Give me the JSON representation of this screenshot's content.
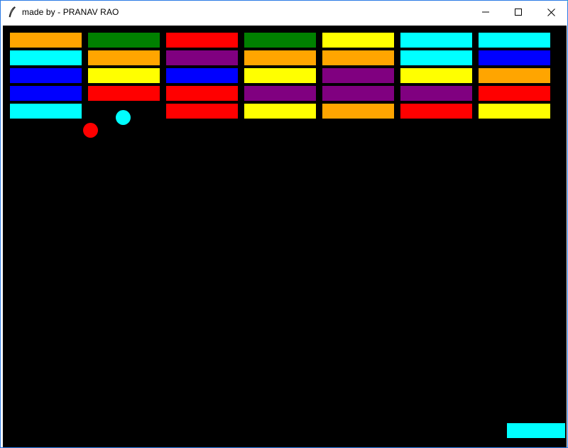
{
  "window": {
    "title": "made by - PRANAV RAO",
    "app_icon": "feather-icon",
    "controls": [
      "minimize-icon",
      "maximize-icon",
      "close-icon"
    ],
    "accent": "#2c7be5"
  },
  "game": {
    "background": "#000000",
    "brick_rows": [
      [
        "#ffa500",
        "#008000",
        "#ff0000",
        "#008000",
        "#ffff00",
        "#00ffff",
        "#00ffff"
      ],
      [
        "#00ffff",
        "#ffa500",
        "#800080",
        "#ffa500",
        "#ffa500",
        "#00ffff",
        "#0000ff"
      ],
      [
        "#0000ff",
        "#ffff00",
        "#0000ff",
        "#ffff00",
        "#800080",
        "#ffff00",
        "#ffa500"
      ],
      [
        "#0000ff",
        "#ff0000",
        "#ff0000",
        "#800080",
        "#800080",
        "#800080",
        "#ff0000"
      ],
      [
        "#00ffff",
        null,
        "#ff0000",
        "#ffff00",
        "#ffa500",
        "#ff0000",
        "#ffff00"
      ]
    ],
    "balls": [
      {
        "color": "#ff0000"
      },
      {
        "color": "#00ffff"
      }
    ],
    "paddle": {
      "color": "#00ffff"
    }
  }
}
